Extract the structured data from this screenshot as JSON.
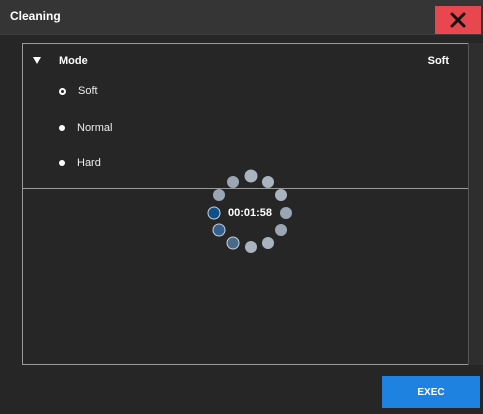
{
  "window": {
    "title": "Cleaning",
    "close_icon": "close-x-icon"
  },
  "mode": {
    "label": "Mode",
    "selected": "Soft",
    "options": [
      "Soft",
      "Normal",
      "Hard"
    ]
  },
  "progress": {
    "elapsed": "00:01:58"
  },
  "actions": {
    "exec_label": "EXEC"
  },
  "colors": {
    "accent": "#1e82e0",
    "close": "#e8474f",
    "background": "#262626"
  }
}
